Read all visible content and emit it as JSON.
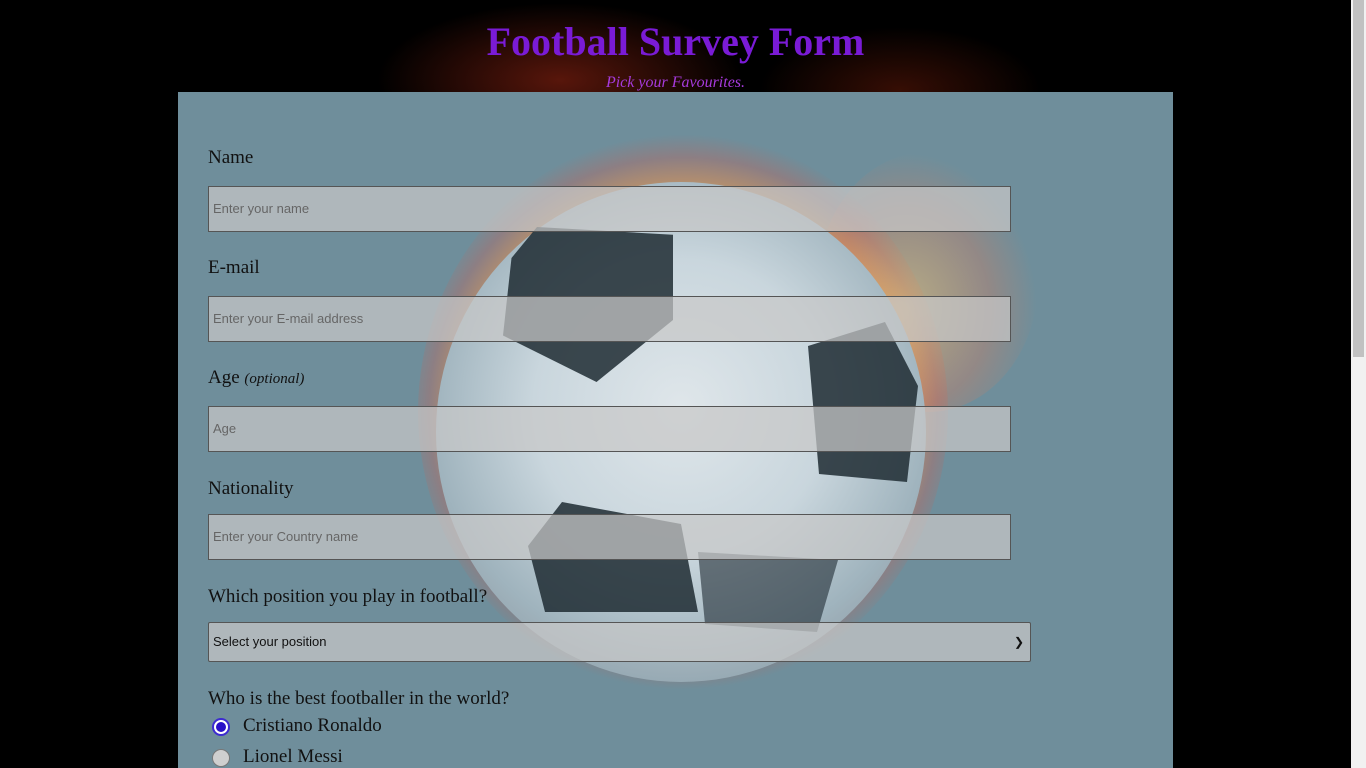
{
  "header": {
    "title": "Football Survey Form",
    "subtitle": "Pick your Favourites."
  },
  "form": {
    "name": {
      "label": "Name",
      "placeholder": "Enter your name"
    },
    "email": {
      "label": "E-mail",
      "placeholder": "Enter your E-mail address"
    },
    "age": {
      "label": "Age",
      "label_note": "(optional)",
      "placeholder": "Age"
    },
    "nationality": {
      "label": "Nationality",
      "placeholder": "Enter your Country name"
    },
    "position": {
      "label": "Which position you play in football?",
      "selected": "Select your position"
    },
    "best_player": {
      "label": "Who is the best footballer in the world?",
      "options": [
        {
          "label": "Cristiano Ronaldo",
          "checked": true
        },
        {
          "label": "Lionel Messi",
          "checked": false
        }
      ]
    }
  },
  "colors": {
    "title": "#7a1bd6",
    "form_background": "#6f8e9b",
    "radio_accent": "#2a10c8"
  }
}
